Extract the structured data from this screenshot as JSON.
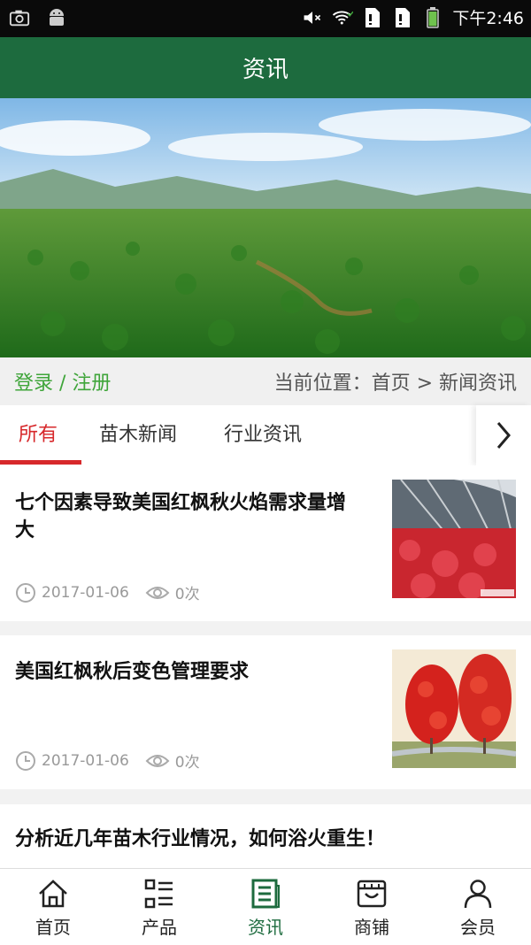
{
  "status_bar": {
    "time": "下午2:46",
    "icons": [
      "screenshot-icon",
      "android-icon",
      "mute-icon",
      "wifi-icon",
      "sim1-icon",
      "sim2-icon",
      "battery-icon"
    ]
  },
  "header": {
    "title": "资讯"
  },
  "colors": {
    "header": "#1d6b3e",
    "accent_red": "#d7282b",
    "login_green": "#3fa53a"
  },
  "breadcrumb": {
    "login": "登录 / 注册",
    "location": "当前位置：首页 > 新闻资讯"
  },
  "tabs": [
    {
      "label": "所有",
      "active": true
    },
    {
      "label": "苗木新闻",
      "active": false
    },
    {
      "label": "行业资讯",
      "active": false
    }
  ],
  "news": [
    {
      "title": "七个因素导致美国红枫秋火焰需求量增大",
      "date": "2017-01-06",
      "views": "0次"
    },
    {
      "title": "美国红枫秋后变色管理要求",
      "date": "2017-01-06",
      "views": "0次"
    },
    {
      "title": "分析近几年苗木行业情况，如何浴火重生！"
    }
  ],
  "tabbar": [
    {
      "label": "首页",
      "icon": "home-icon"
    },
    {
      "label": "产品",
      "icon": "product-list-icon"
    },
    {
      "label": "资讯",
      "icon": "news-icon",
      "active": true
    },
    {
      "label": "商铺",
      "icon": "shop-icon"
    },
    {
      "label": "会员",
      "icon": "user-icon"
    }
  ]
}
